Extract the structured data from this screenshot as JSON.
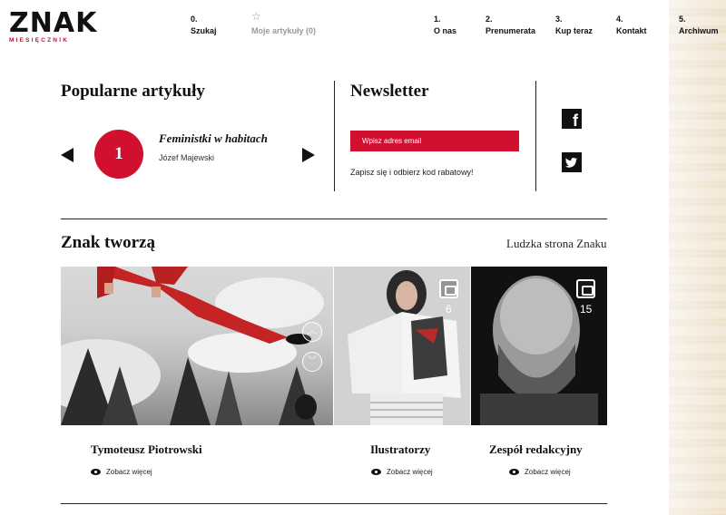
{
  "header": {
    "logo_text": "ZNAK",
    "logo_sub": "MIESIĘCZNIK",
    "left_nav": [
      {
        "num": "0.",
        "label": "Szukaj"
      },
      {
        "num": "",
        "label": "Moje artykuły (0)"
      }
    ],
    "right_nav": [
      {
        "num": "1.",
        "label": "O nas"
      },
      {
        "num": "2.",
        "label": "Prenumerata"
      },
      {
        "num": "3.",
        "label": "Kup teraz"
      },
      {
        "num": "4.",
        "label": "Kontakt"
      },
      {
        "num": "5.",
        "label": "Archiwum"
      }
    ]
  },
  "popular": {
    "heading": "Popularne artykuły",
    "rank": "1",
    "title": "Feministki w habitach",
    "author": "Józef Majewski"
  },
  "newsletter": {
    "heading": "Newsletter",
    "input_placeholder": "Wpisz adres email",
    "note": "Zapisz się i odbierz kod rabatowy!"
  },
  "social": {
    "icons": [
      "facebook-icon",
      "twitter-icon"
    ]
  },
  "creators": {
    "heading": "Znak tworzą",
    "side_link": "Ludzka strona Znaku",
    "tiles": [
      {
        "name": "Tymoteusz Piotrowski",
        "count": "",
        "see_more": "Zobacz więcej"
      },
      {
        "name": "Ilustratorzy",
        "count": "6",
        "see_more": "Zobacz więcej"
      },
      {
        "name": "Zespół redakcyjny",
        "count": "15",
        "see_more": "Zobacz więcej"
      }
    ]
  },
  "colors": {
    "accent": "#d10f2f",
    "text": "#111111"
  }
}
